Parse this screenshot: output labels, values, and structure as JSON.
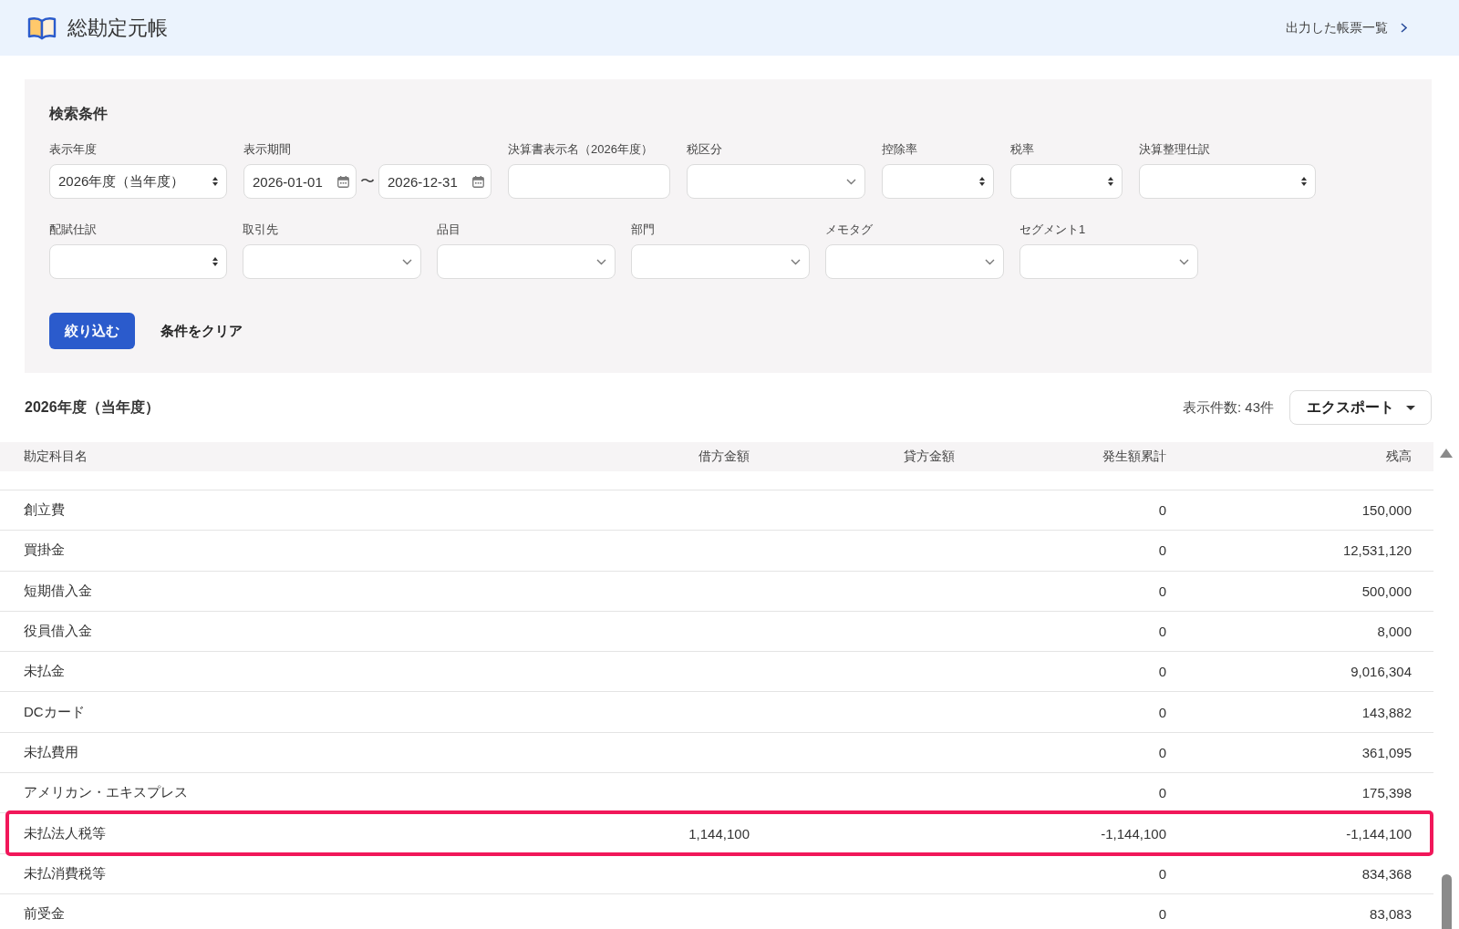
{
  "header": {
    "title": "総勘定元帳",
    "report_list_link": "出力した帳票一覧"
  },
  "search_panel": {
    "title": "検索条件",
    "filter_rows": [
      [
        {
          "label": "表示年度",
          "kind": "select",
          "value": "2026年度（当年度）"
        },
        {
          "label": "表示期間",
          "kind": "date_range",
          "from": "2026-01-01",
          "separator": "〜",
          "to": "2026-12-31"
        },
        {
          "label": "決算書表示名（2026年度）",
          "kind": "text"
        },
        {
          "label": "税区分",
          "kind": "dropdown"
        },
        {
          "label": "控除率",
          "kind": "select"
        },
        {
          "label": "税率",
          "kind": "select"
        },
        {
          "label": "決算整理仕訳",
          "kind": "select"
        }
      ],
      [
        {
          "label": "配賦仕訳",
          "kind": "select"
        },
        {
          "label": "取引先",
          "kind": "dropdown"
        },
        {
          "label": "品目",
          "kind": "dropdown"
        },
        {
          "label": "部門",
          "kind": "dropdown"
        },
        {
          "label": "メモタグ",
          "kind": "dropdown"
        },
        {
          "label": "セグメント1",
          "kind": "dropdown"
        }
      ]
    ],
    "buttons": [
      {
        "label": "絞り込む",
        "kind": "primary"
      },
      {
        "label": "条件をクリア",
        "kind": "plain"
      }
    ]
  },
  "results": {
    "title": "2026年度（当年度）",
    "count": "表示件数: 43件",
    "export_button": "エクスポート"
  },
  "table": {
    "columns": [
      "勘定科目名",
      "借方金額",
      "貸方金額",
      "発生額累計",
      "残高"
    ],
    "rows": [
      {
        "account": "創立費",
        "cumulative": "0",
        "balance": "150,000",
        "highlighted": false
      },
      {
        "account": "買掛金",
        "cumulative": "0",
        "balance": "12,531,120",
        "highlighted": false
      },
      {
        "account": "短期借入金",
        "cumulative": "0",
        "balance": "500,000",
        "highlighted": false
      },
      {
        "account": "役員借入金",
        "cumulative": "0",
        "balance": "8,000",
        "highlighted": false
      },
      {
        "account": "未払金",
        "cumulative": "0",
        "balance": "9,016,304",
        "highlighted": false
      },
      {
        "account": "DCカード",
        "cumulative": "0",
        "balance": "143,882",
        "highlighted": false
      },
      {
        "account": "未払費用",
        "cumulative": "0",
        "balance": "361,095",
        "highlighted": false
      },
      {
        "account": "アメリカン・エキスプレス",
        "cumulative": "0",
        "balance": "175,398",
        "highlighted": false
      },
      {
        "account": "未払法人税等",
        "debit": "1,144,100",
        "cumulative": "-1,144,100",
        "balance": "-1,144,100",
        "highlighted": true
      },
      {
        "account": "未払消費税等",
        "cumulative": "0",
        "balance": "834,368",
        "highlighted": false
      },
      {
        "account": "前受金",
        "cumulative": "0",
        "balance": "83,083",
        "highlighted": false
      }
    ]
  }
}
